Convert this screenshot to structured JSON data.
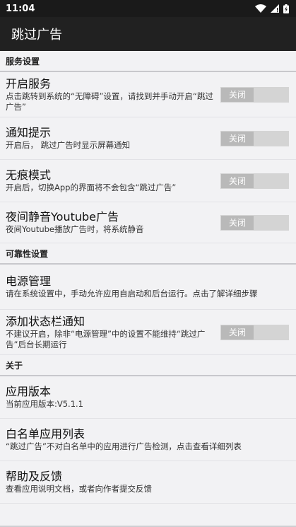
{
  "status_bar": {
    "time": "11:04"
  },
  "app_bar": {
    "title": "跳过广告"
  },
  "sections": {
    "service": {
      "header": "服务设置"
    },
    "reliability": {
      "header": "可靠性设置"
    },
    "about": {
      "header": "关于"
    }
  },
  "items": {
    "enable_service": {
      "title": "开启服务",
      "summary": "点击跳转到系统的“无障碍”设置，请找到并手动开启“跳过广告”",
      "toggle": "关闭"
    },
    "notify": {
      "title": "通知提示",
      "summary": "开启后， 跳过广告时显示屏幕通知",
      "toggle": "关闭"
    },
    "incognito": {
      "title": "无痕模式",
      "summary": "开启后，切换App的界面将不会包含“跳过广告”",
      "toggle": "关闭"
    },
    "youtube_mute": {
      "title": "夜间静音Youtube广告",
      "summary": "夜间Youtube播放广告时，将系统静音",
      "toggle": "关闭"
    },
    "power": {
      "title": "电源管理",
      "summary": "请在系统设置中，手动允许应用自启动和后台运行。点击了解详细步骤"
    },
    "statusbar_notice": {
      "title": "添加状态栏通知",
      "summary": "不建议开启，除非“电源管理”中的设置不能维持“跳过广告”后台长期运行",
      "toggle": "关闭"
    },
    "version": {
      "title": "应用版本",
      "summary": "当前应用版本:V5.1.1"
    },
    "whitelist": {
      "title": "白名单应用列表",
      "summary": "“跳过广告”不对白名单中的应用进行广告检测，点击查看详细列表"
    },
    "help": {
      "title": "帮助及反馈",
      "summary": "查看应用说明文档，或者向作者提交反馈"
    }
  }
}
